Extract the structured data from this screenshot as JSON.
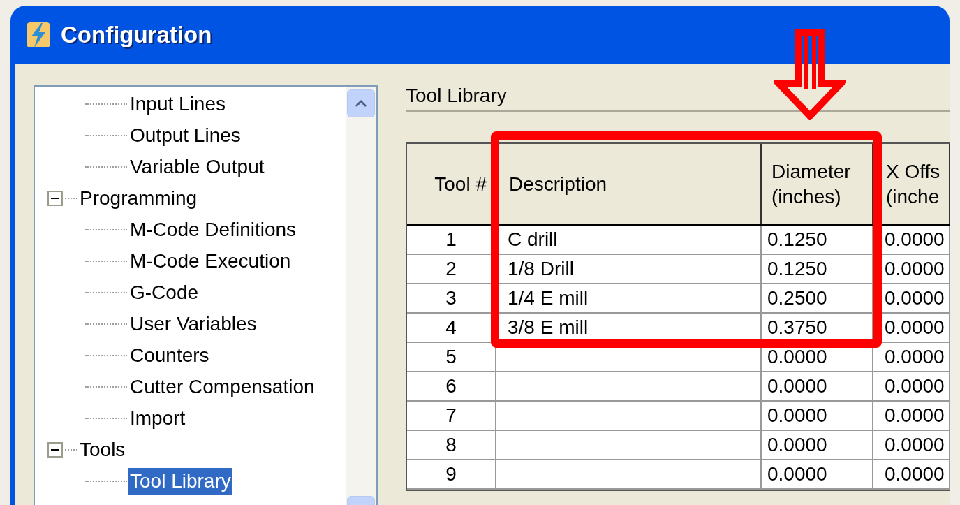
{
  "window": {
    "title": "Configuration"
  },
  "tree": {
    "continued_items": [
      {
        "label": "Input Lines",
        "selected": false
      },
      {
        "label": "Output Lines",
        "selected": false
      },
      {
        "label": "Variable Output",
        "selected": false
      }
    ],
    "items": [
      {
        "label": "Programming",
        "expanded": true,
        "children": [
          {
            "label": "M-Code Definitions",
            "selected": false
          },
          {
            "label": "M-Code Execution",
            "selected": false
          },
          {
            "label": "G-Code",
            "selected": false
          },
          {
            "label": "User Variables",
            "selected": false
          },
          {
            "label": "Counters",
            "selected": false
          },
          {
            "label": "Cutter Compensation",
            "selected": false
          },
          {
            "label": "Import",
            "selected": false
          }
        ]
      },
      {
        "label": "Tools",
        "expanded": true,
        "children": [
          {
            "label": "Tool Library",
            "selected": true
          }
        ]
      }
    ]
  },
  "panel": {
    "title": "Tool Library"
  },
  "table": {
    "columns": [
      "Tool #",
      "Description",
      "Diameter (inches)",
      "X Offs (inche"
    ],
    "rows": [
      [
        "1",
        "C drill",
        "0.1250",
        "0.0000"
      ],
      [
        "2",
        "1/8 Drill",
        "0.1250",
        "0.0000"
      ],
      [
        "3",
        "1/4 E mill",
        "0.2500",
        "0.0000"
      ],
      [
        "4",
        "3/8 E mill",
        "0.3750",
        "0.0000"
      ],
      [
        "5",
        "",
        "0.0000",
        "0.0000"
      ],
      [
        "6",
        "",
        "0.0000",
        "0.0000"
      ],
      [
        "7",
        "",
        "0.0000",
        "0.0000"
      ],
      [
        "8",
        "",
        "0.0000",
        "0.0000"
      ],
      [
        "9",
        "",
        "0.0000",
        "0.0000"
      ]
    ]
  }
}
